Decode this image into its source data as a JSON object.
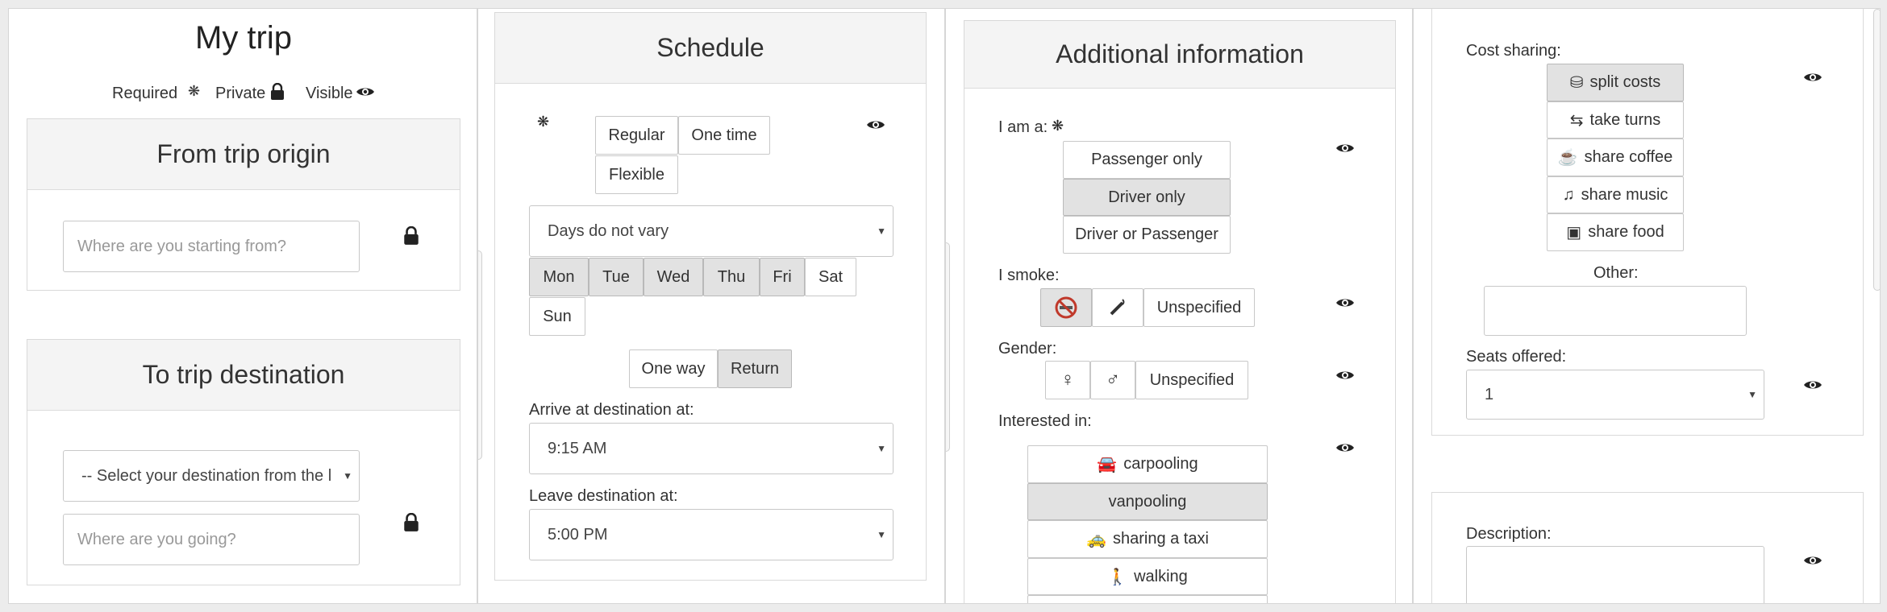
{
  "my_trip": {
    "title": "My trip",
    "legend": {
      "required": "Required",
      "private": "Private",
      "visible": "Visible"
    }
  },
  "origin": {
    "heading": "From trip origin",
    "placeholder": "Where are you starting from?"
  },
  "destination": {
    "heading": "To trip destination",
    "select_value": "-- Select your destination from the l",
    "placeholder": "Where are you going?"
  },
  "schedule": {
    "heading": "Schedule",
    "types": [
      "Regular",
      "One time",
      "Flexible"
    ],
    "days_select": "Days do not vary",
    "days": [
      "Mon",
      "Tue",
      "Wed",
      "Thu",
      "Fri",
      "Sat",
      "Sun"
    ],
    "active_days": [
      "Mon",
      "Tue",
      "Wed",
      "Thu",
      "Fri"
    ],
    "trip_types": [
      "One way",
      "Return"
    ],
    "active_trip_type": "Return",
    "arrive_label": "Arrive at destination at:",
    "arrive_value": "9:15 AM",
    "leave_label": "Leave destination at:",
    "leave_value": "5:00 PM"
  },
  "additional": {
    "heading": "Additional information",
    "i_am_label": "I am a:",
    "roles": [
      "Passenger only",
      "Driver only",
      "Driver or Passenger"
    ],
    "active_role": "Driver only",
    "smoke_label": "I smoke:",
    "smoke_unspecified": "Unspecified",
    "gender_label": "Gender:",
    "gender_unspecified": "Unspecified",
    "interested_label": "Interested in:",
    "interests": [
      "carpooling",
      "vanpooling",
      "sharing a taxi",
      "walking"
    ],
    "active_interest": "vanpooling"
  },
  "cost": {
    "label": "Cost sharing:",
    "options": [
      "split costs",
      "take turns",
      "share coffee",
      "share music",
      "share food"
    ],
    "active_option": "split costs",
    "other_label": "Other:",
    "seats_label": "Seats offered:",
    "seats_value": "1",
    "description_label": "Description:"
  },
  "icons": {
    "required": "asterisk-icon",
    "private": "lock-icon",
    "visible": "eye-icon"
  }
}
